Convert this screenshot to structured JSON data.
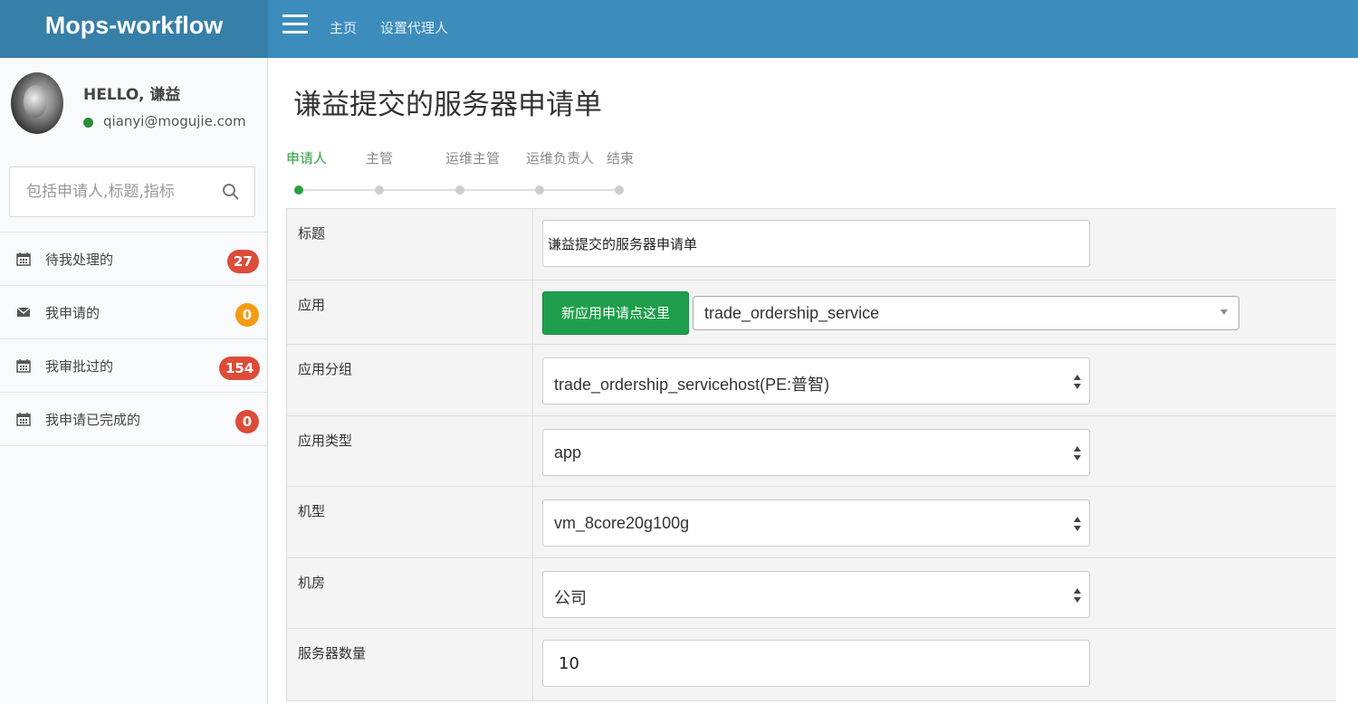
{
  "header": {
    "logo": "Mops-workflow",
    "nav": [
      {
        "label": "主页"
      },
      {
        "label": "设置代理人"
      }
    ]
  },
  "user": {
    "greeting": "HELLO, 谦益",
    "email": "qianyi@mogujie.com",
    "status_color": "#2e8b3a"
  },
  "sidebar": {
    "search_placeholder": "包括申请人,标题,指标",
    "items": [
      {
        "icon": "calendar-icon",
        "label": "待我处理的",
        "count": "27",
        "badge_color": "#dd4b39"
      },
      {
        "icon": "envelope-icon",
        "label": "我申请的",
        "count": "0",
        "badge_color": "#f39c12"
      },
      {
        "icon": "calendar-icon",
        "label": "我审批过的",
        "count": "154",
        "badge_color": "#dd4b39"
      },
      {
        "icon": "calendar-icon",
        "label": "我申请已完成的",
        "count": "0",
        "badge_color": "#dd4b39"
      }
    ]
  },
  "page": {
    "title": "谦益提交的服务器申请单"
  },
  "steps": [
    {
      "label": "申请人",
      "active": true
    },
    {
      "label": "主管",
      "active": false
    },
    {
      "label": "运维主管",
      "active": false
    },
    {
      "label": "运维负责人",
      "active": false
    },
    {
      "label": "结束",
      "active": false
    }
  ],
  "form": {
    "title": {
      "label": "标题",
      "value": "谦益提交的服务器申请单"
    },
    "app": {
      "label": "应用",
      "button": "新应用申请点这里",
      "value": "trade_ordership_service"
    },
    "group": {
      "label": "应用分组",
      "value": "trade_ordership_servicehost(PE:普智)"
    },
    "type": {
      "label": "应用类型",
      "value": "app"
    },
    "model": {
      "label": "机型",
      "value": "vm_8core20g100g"
    },
    "room": {
      "label": "机房",
      "value": "公司"
    },
    "count": {
      "label": "服务器数量",
      "value": "10"
    }
  },
  "colors": {
    "header": "#3c8dbc",
    "logo_bg": "#367fa9",
    "accent_green": "#1e9e4b",
    "step_active": "#2e9e3e"
  }
}
